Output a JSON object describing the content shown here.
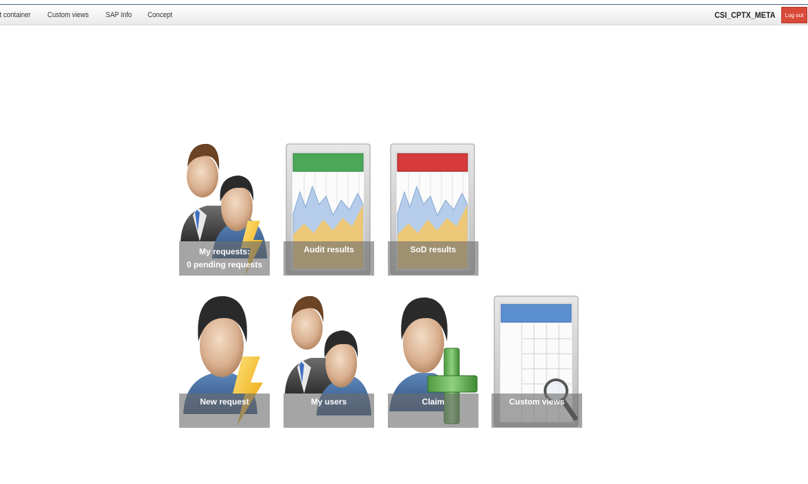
{
  "nav": {
    "items": [
      "ult container",
      "Custom views",
      "SAP Info",
      "Concept"
    ],
    "username": "CSI_CPTX_META",
    "logout_label": "Log out"
  },
  "tiles": [
    {
      "label": "My requests:",
      "sublabel": "0 pending requests",
      "icon": "two-users-lightning-icon"
    },
    {
      "label": "Audit results",
      "icon": "audit-chart-icon"
    },
    {
      "label": "SoD results",
      "icon": "sod-chart-icon"
    },
    {
      "label": "New request",
      "icon": "user-lightning-icon"
    },
    {
      "label": "My users",
      "icon": "two-users-icon"
    },
    {
      "label": "Claim",
      "icon": "user-plus-icon"
    },
    {
      "label": "Custom views",
      "icon": "table-search-icon"
    }
  ],
  "colors": {
    "logout": "#d94a38",
    "audit_header": "#4aa858",
    "sod_header": "#d63a3a",
    "table_header": "#5b8fd0"
  }
}
